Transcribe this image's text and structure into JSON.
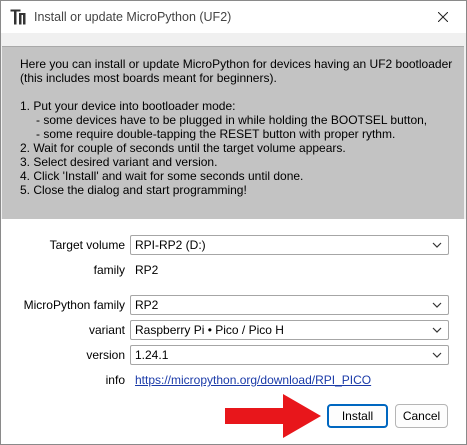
{
  "window": {
    "title": "Install or update MicroPython (UF2)",
    "close_icon": "close-icon",
    "app_icon": "thonny-app-icon"
  },
  "instructions": {
    "intro_1": "Here you can install or update MicroPython for devices having an UF2 bootloader",
    "intro_2": "(this includes most boards meant for beginners).",
    "step_1": "1. Put your device into bootloader mode:",
    "step_1a": "- some devices have to be plugged in while holding the BOOTSEL button,",
    "step_1b": "- some require double-tapping the RESET button with proper rythm.",
    "step_2": "2. Wait for couple of seconds until the target volume appears.",
    "step_3": "3. Select desired variant and version.",
    "step_4": "4. Click 'Install' and wait for some seconds until done.",
    "step_5": "5. Close the dialog and start programming!"
  },
  "form": {
    "target_volume_label": "Target volume",
    "target_volume_value": "RPI-RP2 (D:)",
    "family_label": "family",
    "family_value": "RP2",
    "mp_family_label": "MicroPython family",
    "mp_family_value": "RP2",
    "variant_label": "variant",
    "variant_value": "Raspberry Pi • Pico / Pico H",
    "version_label": "version",
    "version_value": "1.24.1",
    "info_label": "info",
    "info_link": "https://micropython.org/download/RPI_PICO"
  },
  "buttons": {
    "install": "Install",
    "cancel": "Cancel"
  },
  "colors": {
    "instructions_bg": "#c3c3c3",
    "link": "#1a3aa8",
    "primary_border": "#0067c0",
    "arrow": "#e8161b"
  }
}
